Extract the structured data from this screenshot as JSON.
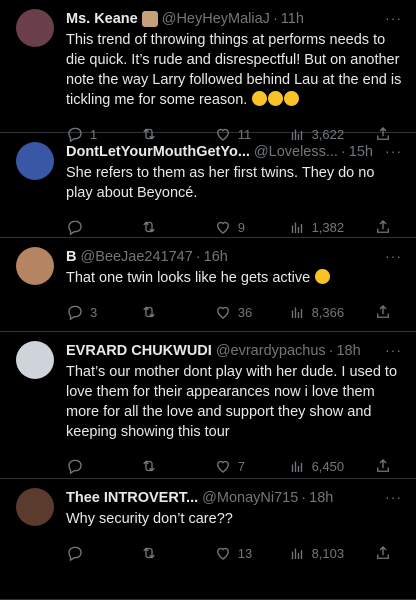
{
  "tweets": [
    {
      "name": "Ms. Keane",
      "handle": "@HeyHeyMaliaJ",
      "time": "11h",
      "text": "This trend of throwing things at performs needs to die quick. It’s rude and disrespectful! But on another note the way Larry followed behind Lau at the end is tickling me for some reason.",
      "reply_count": "1",
      "retweet_count": "",
      "like_count": "11",
      "view_count": "3,622",
      "emoji_count": 3,
      "has_badge": true,
      "avatar_color": "#6b3f49"
    },
    {
      "name": "DontLetYourMouthGetYo...",
      "handle": "@Loveless...",
      "time": "15h",
      "text": "She refers to them as her first twins. They do no play about Beyoncé.",
      "reply_count": "",
      "retweet_count": "",
      "like_count": "9",
      "view_count": "1,382",
      "emoji_count": 0,
      "has_badge": false,
      "avatar_color": "#3a57a6"
    },
    {
      "name": "B",
      "handle": "@BeeJae241747",
      "time": "16h",
      "text": "That one twin looks like he gets active",
      "reply_count": "3",
      "retweet_count": "",
      "like_count": "36",
      "view_count": "8,366",
      "emoji_count": 1,
      "has_badge": false,
      "avatar_color": "#b58461"
    },
    {
      "name": "EVRARD CHUKWUDI",
      "handle": "@evrardypachus",
      "time": "18h",
      "text": "That’s our mother dont play with her dude. I used to love them for their appearances now i love them more for all the love and support they show and keeping showing this tour",
      "reply_count": "",
      "retweet_count": "",
      "like_count": "7",
      "view_count": "6,450",
      "emoji_count": 0,
      "has_badge": false,
      "avatar_color": "#cfd4da"
    },
    {
      "name": "Thee INTROVERT...",
      "handle": "@MonayNi715",
      "time": "18h",
      "text": "Why security don’t care??",
      "reply_count": "",
      "retweet_count": "",
      "like_count": "13",
      "view_count": "8,103",
      "emoji_count": 0,
      "has_badge": false,
      "avatar_color": "#5b3b2e"
    }
  ],
  "ui": {
    "dot": "·",
    "more": "···"
  }
}
